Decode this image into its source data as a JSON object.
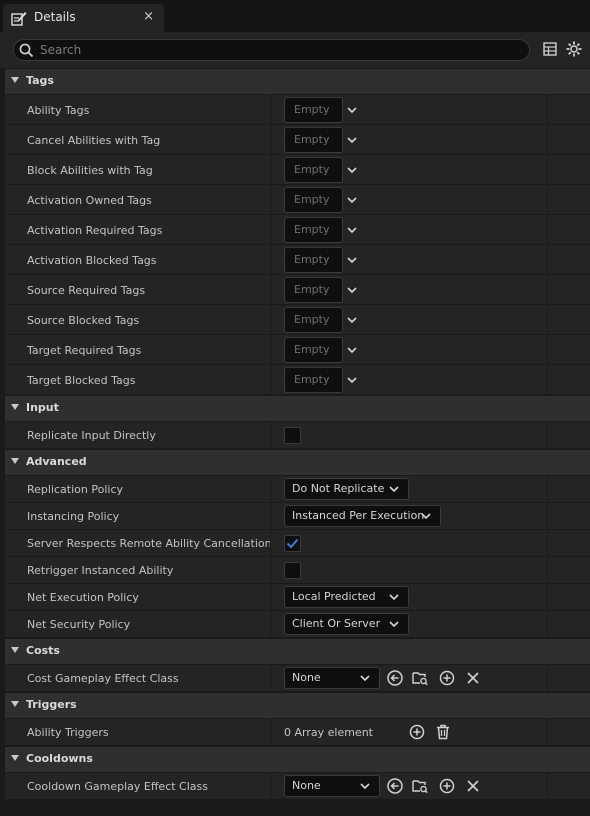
{
  "tab": {
    "title": "Details",
    "close_glyph": "×",
    "icon": "pencil-document-icon"
  },
  "search": {
    "placeholder": "Search"
  },
  "toolbar": {
    "icons": [
      "table-view-icon",
      "settings-gear-icon"
    ]
  },
  "sections": {
    "tags": {
      "title": "Tags",
      "rows": [
        {
          "label": "Ability Tags",
          "value": "Empty"
        },
        {
          "label": "Cancel Abilities with Tag",
          "value": "Empty"
        },
        {
          "label": "Block Abilities with Tag",
          "value": "Empty"
        },
        {
          "label": "Activation Owned Tags",
          "value": "Empty"
        },
        {
          "label": "Activation Required Tags",
          "value": "Empty"
        },
        {
          "label": "Activation Blocked Tags",
          "value": "Empty"
        },
        {
          "label": "Source Required Tags",
          "value": "Empty"
        },
        {
          "label": "Source Blocked Tags",
          "value": "Empty"
        },
        {
          "label": "Target Required Tags",
          "value": "Empty"
        },
        {
          "label": "Target Blocked Tags",
          "value": "Empty"
        }
      ]
    },
    "input": {
      "title": "Input",
      "rows": [
        {
          "label": "Replicate Input Directly",
          "checked": false
        }
      ]
    },
    "advanced": {
      "title": "Advanced",
      "replication_policy": {
        "label": "Replication Policy",
        "value": "Do Not Replicate"
      },
      "instancing_policy": {
        "label": "Instancing Policy",
        "value": "Instanced Per Execution"
      },
      "server_respects": {
        "label": "Server Respects Remote Ability Cancellation",
        "checked": true
      },
      "retrigger": {
        "label": "Retrigger Instanced Ability",
        "checked": false
      },
      "net_execution": {
        "label": "Net Execution Policy",
        "value": "Local Predicted"
      },
      "net_security": {
        "label": "Net Security Policy",
        "value": "Client Or Server"
      }
    },
    "costs": {
      "title": "Costs",
      "cost_class": {
        "label": "Cost Gameplay Effect Class",
        "value": "None"
      }
    },
    "triggers": {
      "title": "Triggers",
      "ability_triggers": {
        "label": "Ability Triggers",
        "value": "0 Array element"
      }
    },
    "cooldowns": {
      "title": "Cooldowns",
      "cooldown_class": {
        "label": "Cooldown Gameplay Effect Class",
        "value": "None"
      }
    }
  },
  "colors": {
    "background": "#1a1a1a",
    "row": "#242424",
    "section_header": "#2f2f2f",
    "checkmark": "#3d7be0"
  }
}
